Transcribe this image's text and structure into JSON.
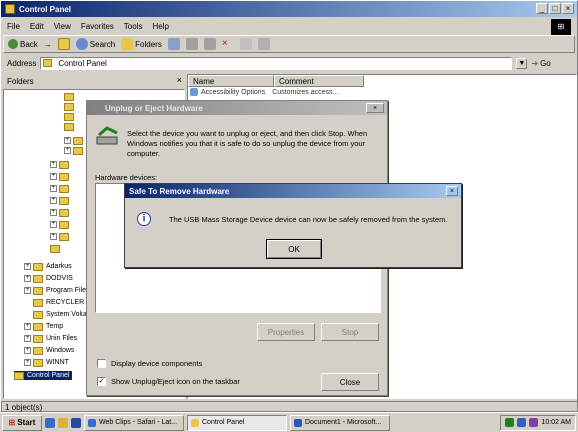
{
  "main_window": {
    "title": "Control Panel",
    "title_buttons": [
      "_",
      "□",
      "×"
    ],
    "menu": [
      "File",
      "Edit",
      "View",
      "Favorites",
      "Tools",
      "Help"
    ],
    "toolbar": {
      "back": "Back",
      "forward": "→",
      "search": "Search",
      "folders": "Folders"
    },
    "address": {
      "label": "Address",
      "value": "Control Panel",
      "go": "Go"
    },
    "folders_pane": {
      "title": "Folders",
      "close": "×"
    },
    "tree_items": [
      {
        "label": "Adarkus",
        "expand": "+"
      },
      {
        "label": "DODVIS",
        "expand": "+"
      },
      {
        "label": "Program Files",
        "expand": "+"
      },
      {
        "label": "RECYCLER",
        "expand": ""
      },
      {
        "label": "System Volume",
        "expand": ""
      },
      {
        "label": "Temp",
        "expand": "+"
      },
      {
        "label": "Unin Files",
        "expand": "+"
      },
      {
        "label": "Windows",
        "expand": "+"
      },
      {
        "label": "WINNT",
        "expand": "+"
      },
      {
        "label": "Control Panel",
        "expand": ""
      }
    ],
    "columns": {
      "name": "Name",
      "comment": "Comment"
    },
    "list_rows": [
      {
        "name": "Accessibility Options",
        "comment": "Customizes access..."
      }
    ],
    "status": "1 object(s)"
  },
  "unplug_dialog": {
    "title": "Unplug or Eject Hardware",
    "close": "×",
    "instructions": "Select the device you want to unplug or eject, and then click Stop. When Windows notifies you that it is safe to do so unplug the device from your computer.",
    "hardware_label": "Hardware devices:",
    "properties_button": "Properties",
    "stop_button": "Stop",
    "display_components": "Display device components",
    "show_icon": "Show Unplug/Eject icon on the taskbar",
    "close_button": "Close"
  },
  "safe_dialog": {
    "title": "Safe To Remove Hardware",
    "close": "×",
    "icon_glyph": "i",
    "message": "The USB Mass Storage Device device can now be safely removed from the system.",
    "ok_button": "OK"
  },
  "taskbar": {
    "start": "Start",
    "tasks": [
      "Web Clips - Safari - Lat...",
      "Control Panel",
      "Document1 - Microsoft..."
    ],
    "clock": "10:02 AM"
  }
}
